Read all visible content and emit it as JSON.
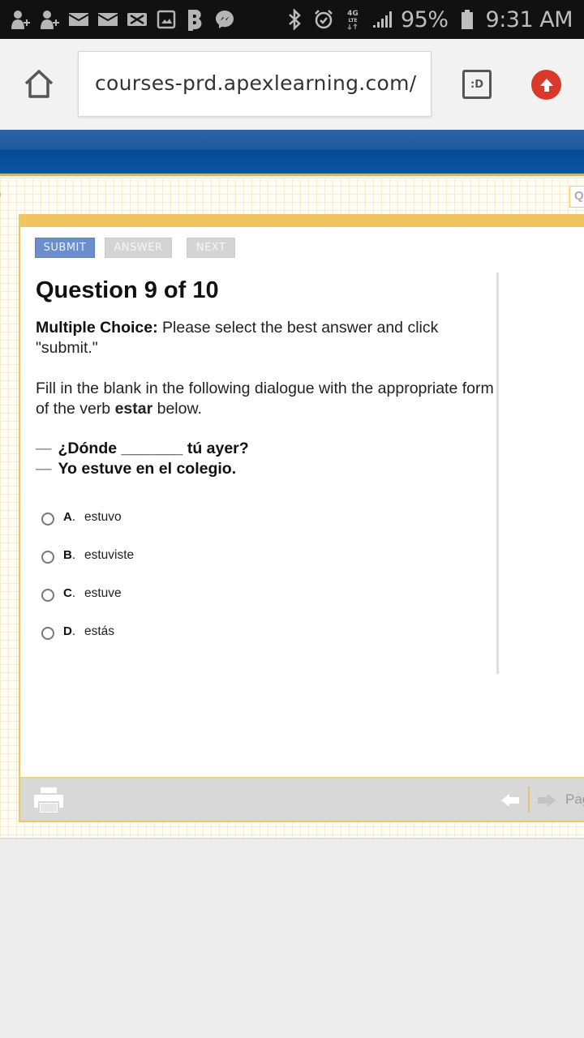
{
  "status_bar": {
    "left_icons": [
      "add-contact-icon",
      "add-contact-icon",
      "mail-icon",
      "mail-icon",
      "mail-x-icon",
      "gallery-icon",
      "b-app-icon",
      "messenger-icon"
    ],
    "right_icons": [
      "bluetooth-icon",
      "alarm-icon",
      "4g-lte-icon",
      "signal-icon"
    ],
    "lte_label": "4G LTE",
    "battery": "95%",
    "time": "9:31 AM"
  },
  "browser": {
    "url": "courses-prd.apexlearning.com/",
    "tab_button_label": ":D"
  },
  "quiz": {
    "buttons": {
      "submit": "SUBMIT",
      "answer": "ANSWER",
      "next": "NEXT"
    },
    "title": "Question 9 of 10",
    "instruction_bold": "Multiple Choice:",
    "instruction_text": " Please select the best answer and click \"submit.\"",
    "prompt_part1": "Fill in the blank in the following dialogue with the appropriate form of the verb ",
    "prompt_bold": "estar",
    "prompt_part2": " below.",
    "dialogue": [
      {
        "dash": "—",
        "text": "¿Dónde _______ tú ayer?"
      },
      {
        "dash": "—",
        "text": "Yo estuve en el colegio."
      }
    ],
    "options": [
      {
        "letter": "A",
        "text": "estuvo",
        "selected": false
      },
      {
        "letter": "B",
        "text": "estuviste",
        "selected": false
      },
      {
        "letter": "C",
        "text": "estuve",
        "selected": false
      },
      {
        "letter": "D",
        "text": "estás",
        "selected": false
      }
    ],
    "footer": {
      "page_label": "Page"
    }
  },
  "colors": {
    "header_blue": "#0a56a4",
    "accent_gold": "#f0c560",
    "submit_blue": "#6b8fcd",
    "upload_red": "#d8392b"
  }
}
